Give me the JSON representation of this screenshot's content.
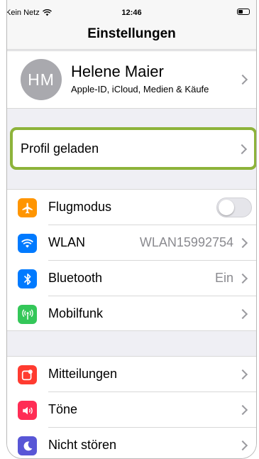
{
  "status_bar": {
    "carrier": "Kein Netz",
    "time": "12:46"
  },
  "nav": {
    "title": "Einstellungen"
  },
  "profile": {
    "initials": "HM",
    "name": "Helene Maier",
    "subtitle": "Apple-ID, iCloud, Medien & Käufe"
  },
  "profile_loaded": {
    "label": "Profil geladen"
  },
  "group1": [
    {
      "label": "Flugmodus",
      "icon": "airplane-icon",
      "color": "#ff9500",
      "toggle_on": false
    },
    {
      "label": "WLAN",
      "value": "WLAN15992754",
      "icon": "wifi-icon",
      "color": "#007aff"
    },
    {
      "label": "Bluetooth",
      "value": "Ein",
      "icon": "bluetooth-icon",
      "color": "#007aff"
    },
    {
      "label": "Mobilfunk",
      "icon": "antenna-icon",
      "color": "#34c759"
    }
  ],
  "group2": [
    {
      "label": "Mitteilungen",
      "icon": "notifications-icon",
      "color": "#ff3b30"
    },
    {
      "label": "Töne",
      "icon": "speaker-icon",
      "color": "#ff2d55"
    },
    {
      "label": "Nicht stören",
      "icon": "moon-icon",
      "color": "#5856d6"
    }
  ],
  "colors": {
    "highlight": "#8db33a",
    "background": "#efeff4"
  }
}
